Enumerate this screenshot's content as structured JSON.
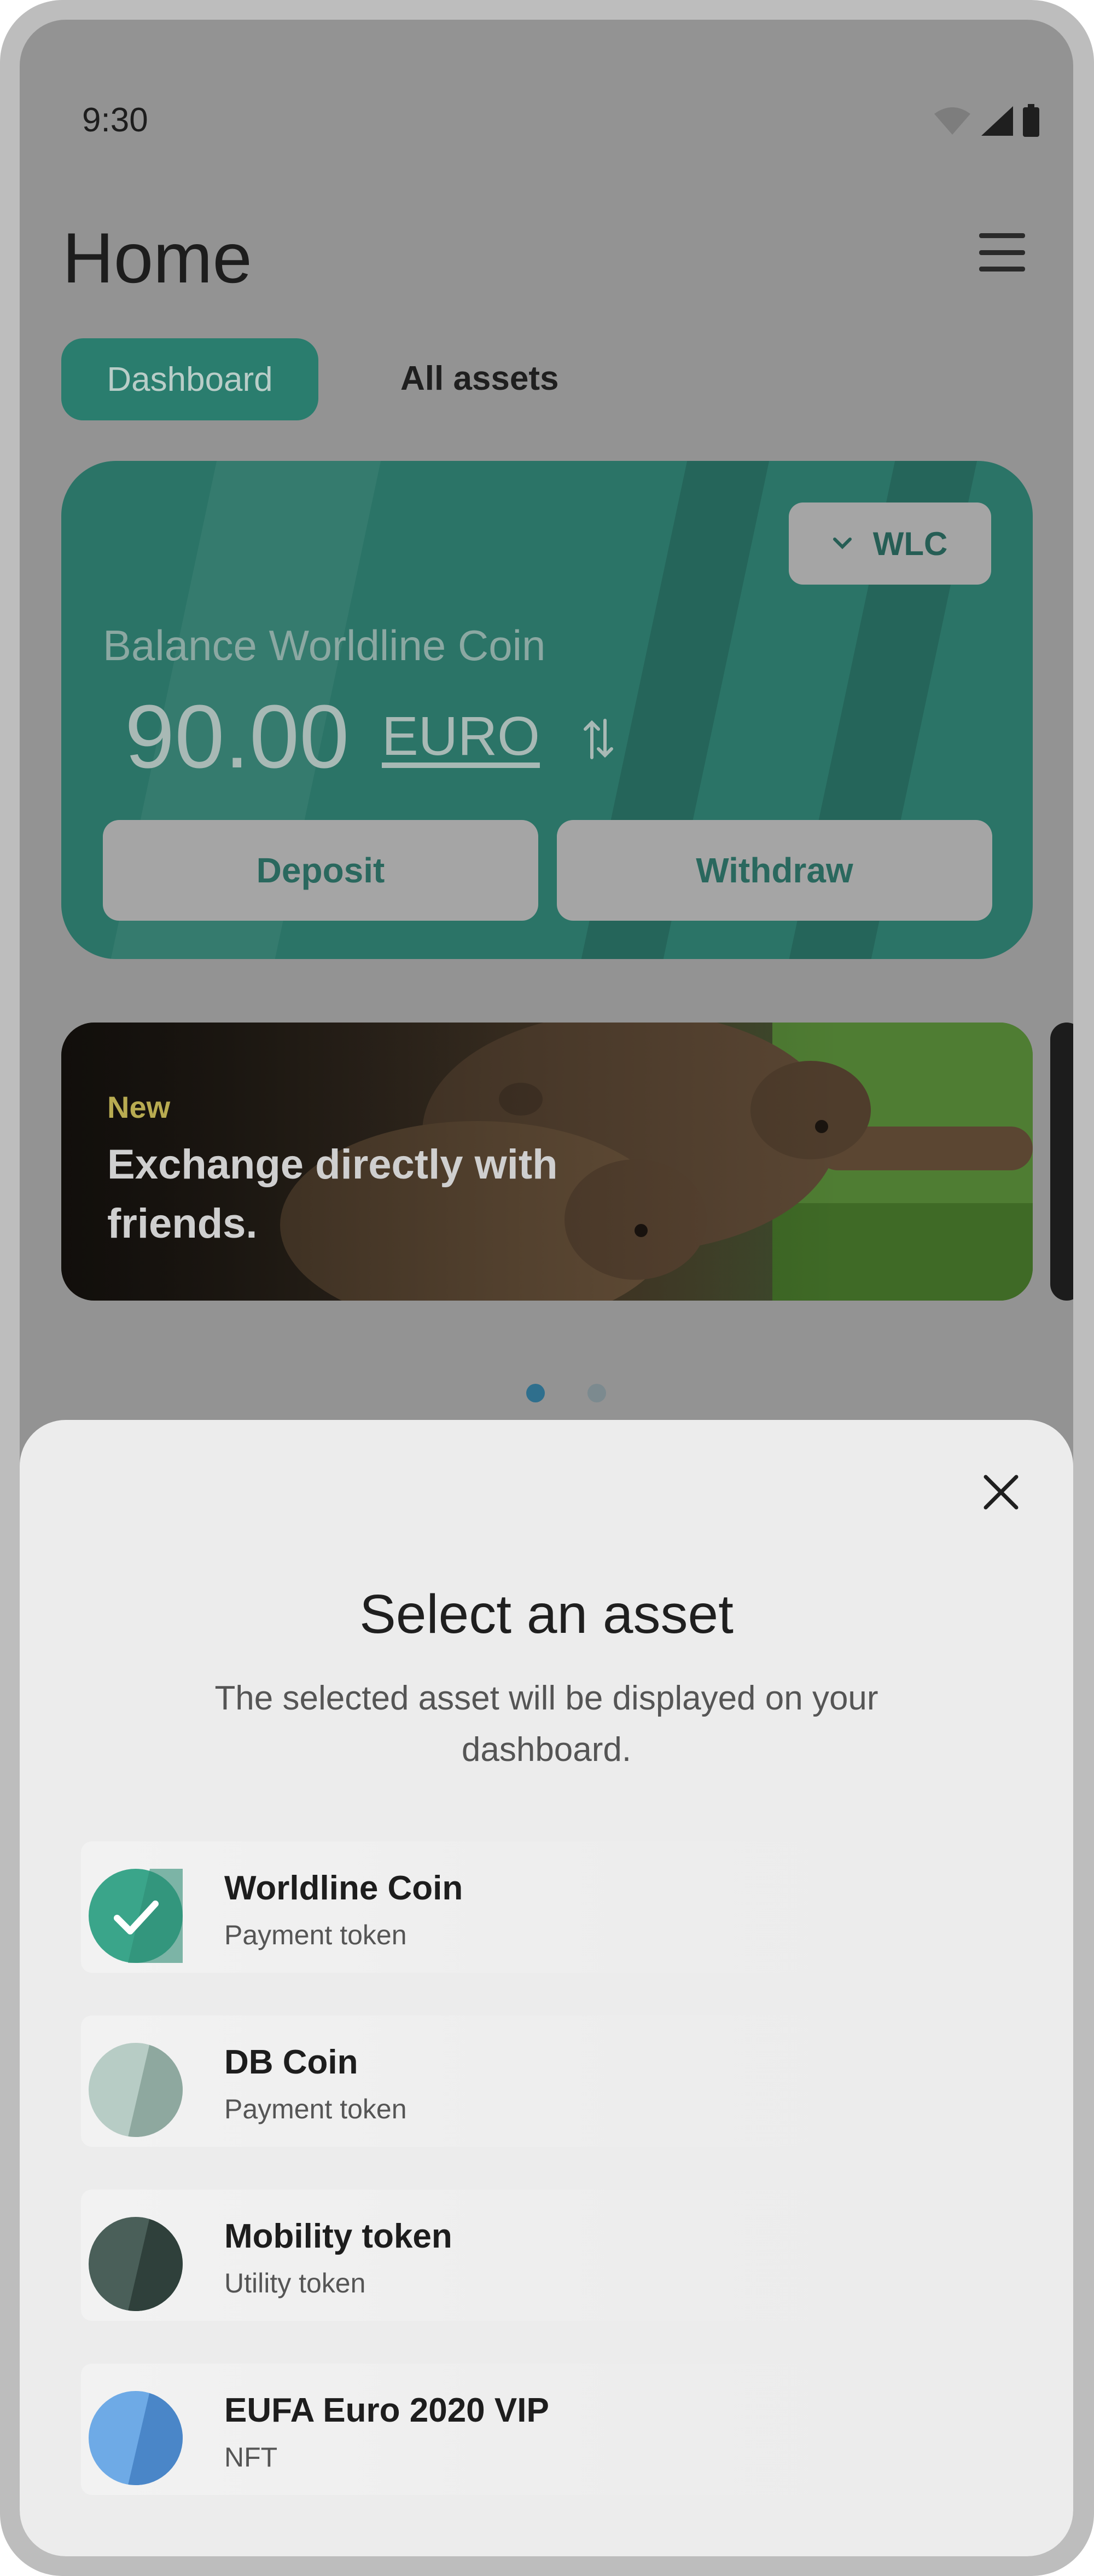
{
  "status_bar": {
    "time": "9:30"
  },
  "header": {
    "title": "Home"
  },
  "tabs": [
    {
      "label": "Dashboard",
      "active": true
    },
    {
      "label": "All assets",
      "active": false
    }
  ],
  "balance_card": {
    "label": "Balance Worldline Coin",
    "amount": "90.00",
    "currency": "EURO",
    "selector_label": "WLC",
    "deposit_label": "Deposit",
    "withdraw_label": "Withdraw"
  },
  "promo": {
    "eyebrow": "New",
    "headline": "Exchange directly with friends."
  },
  "carousel": {
    "pages": 2,
    "active": 1
  },
  "sheet": {
    "title": "Select an asset",
    "subtitle": "The selected asset will be displayed on your dashboard.",
    "assets": [
      {
        "name": "Worldline Coin",
        "type": "Payment token",
        "selected": true,
        "color": "#3aa58a"
      },
      {
        "name": "DB Coin",
        "type": "Payment token",
        "selected": false,
        "color": "#9fbcb3"
      },
      {
        "name": "Mobility token",
        "type": "Utility token",
        "selected": false,
        "color": "#3f5650"
      },
      {
        "name": "EUFA Euro 2020 VIP",
        "type": "NFT",
        "selected": false,
        "color": "#5d9bd8"
      }
    ]
  },
  "colors": {
    "accent": "#2a7d6e",
    "card": "#2b7467",
    "scrim": "#939393",
    "sheet": "#ececec"
  },
  "icons": [
    "wifi-icon",
    "signal-icon",
    "battery-icon",
    "menu-icon",
    "chevron-down-icon",
    "swap-icon",
    "close-icon",
    "check-icon"
  ]
}
